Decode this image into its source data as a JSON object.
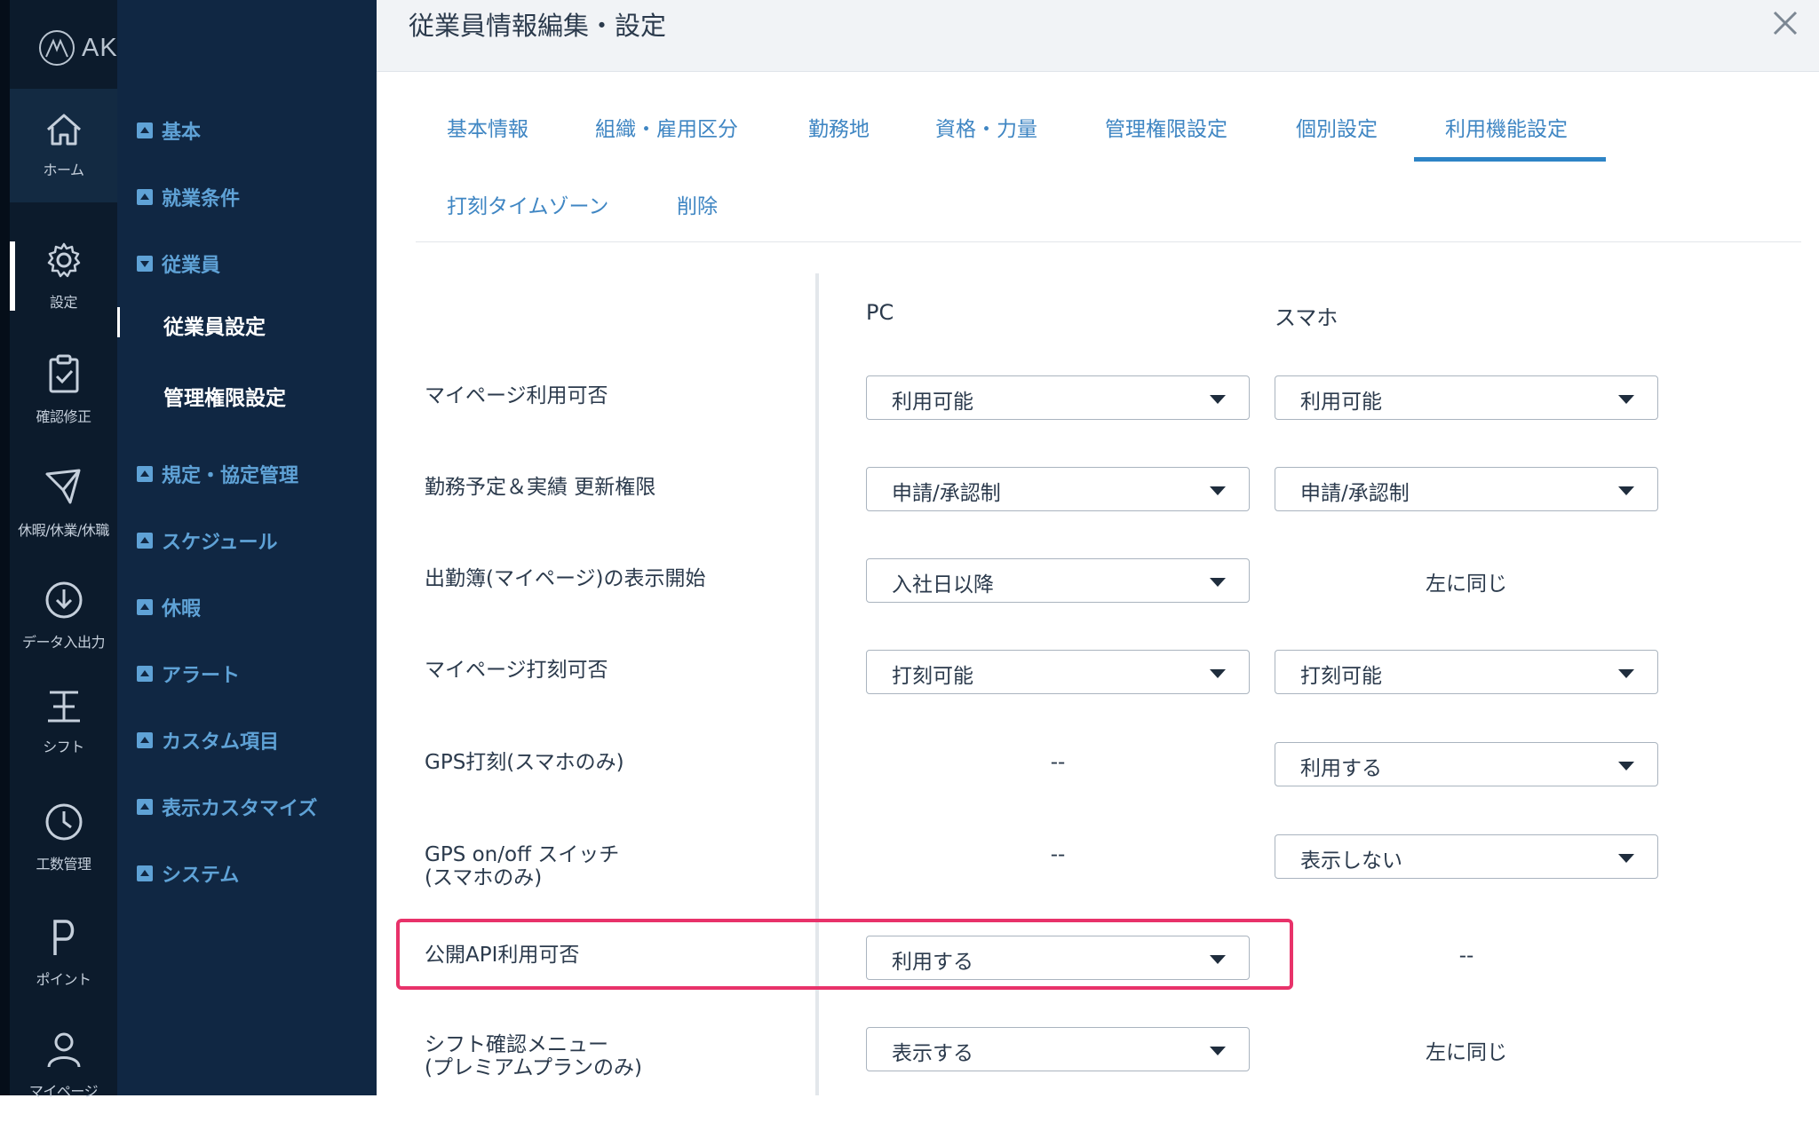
{
  "app": {
    "brand": "AKASHI"
  },
  "rail": {
    "items": [
      {
        "label": "ホーム",
        "icon": "home-icon"
      },
      {
        "label": "設定",
        "icon": "gear-icon"
      },
      {
        "label": "確認修正",
        "icon": "clipboard-check-icon"
      },
      {
        "label": "休暇/休業/休職",
        "icon": "paper-plane-icon"
      },
      {
        "label": "データ入出力",
        "icon": "download-circle-icon"
      },
      {
        "label": "シフト",
        "icon": "shift-icon"
      },
      {
        "label": "工数管理",
        "icon": "clock-icon"
      },
      {
        "label": "ポイント",
        "icon": "point-icon"
      },
      {
        "label": "マイページ",
        "icon": "user-icon"
      }
    ]
  },
  "submenu": {
    "items": [
      {
        "label": "基本"
      },
      {
        "label": "就業条件"
      },
      {
        "label": "従業員"
      },
      {
        "label": "規定・協定管理"
      },
      {
        "label": "スケジュール"
      },
      {
        "label": "休暇"
      },
      {
        "label": "アラート"
      },
      {
        "label": "カスタム項目"
      },
      {
        "label": "表示カスタマイズ"
      },
      {
        "label": "システム"
      }
    ],
    "children": [
      {
        "label": "従業員設定"
      },
      {
        "label": "管理権限設定"
      }
    ]
  },
  "page": {
    "title": "従業員情報編集・設定"
  },
  "tabs": [
    {
      "label": "基本情報"
    },
    {
      "label": "組織・雇用区分"
    },
    {
      "label": "勤務地"
    },
    {
      "label": "資格・力量"
    },
    {
      "label": "管理権限設定"
    },
    {
      "label": "個別設定"
    },
    {
      "label": "利用機能設定"
    },
    {
      "label": "打刻タイムゾーン"
    },
    {
      "label": "削除"
    }
  ],
  "columns": {
    "pc": "PC",
    "sp": "スマホ"
  },
  "rows": [
    {
      "label": "マイページ利用可否",
      "pc": "利用可能",
      "sp": "利用可能"
    },
    {
      "label": "勤務予定＆実績 更新権限",
      "pc": "申請/承認制",
      "sp": "申請/承認制"
    },
    {
      "label": "出勤簿(マイページ)の表示開始",
      "pc": "入社日以降",
      "sp": "左に同じ"
    },
    {
      "label": "マイページ打刻可否",
      "pc": "打刻可能",
      "sp": "打刻可能"
    },
    {
      "label": "GPS打刻(スマホのみ)",
      "pc": "--",
      "sp": "利用する"
    },
    {
      "label": "GPS on/off スイッチ",
      "label2": "(スマホのみ)",
      "pc": "--",
      "sp": "表示しない"
    },
    {
      "label": "公開API利用可否",
      "pc": "利用する",
      "sp": "--"
    },
    {
      "label": "シフト確認メニュー",
      "label2": "(プレミアムプランのみ)",
      "pc": "表示する",
      "sp": "左に同じ"
    }
  ],
  "colors": {
    "rail_bg": "#0c1b2c",
    "submenu_bg": "#102743",
    "accent": "#2e84c6",
    "highlight": "#e8326a"
  }
}
